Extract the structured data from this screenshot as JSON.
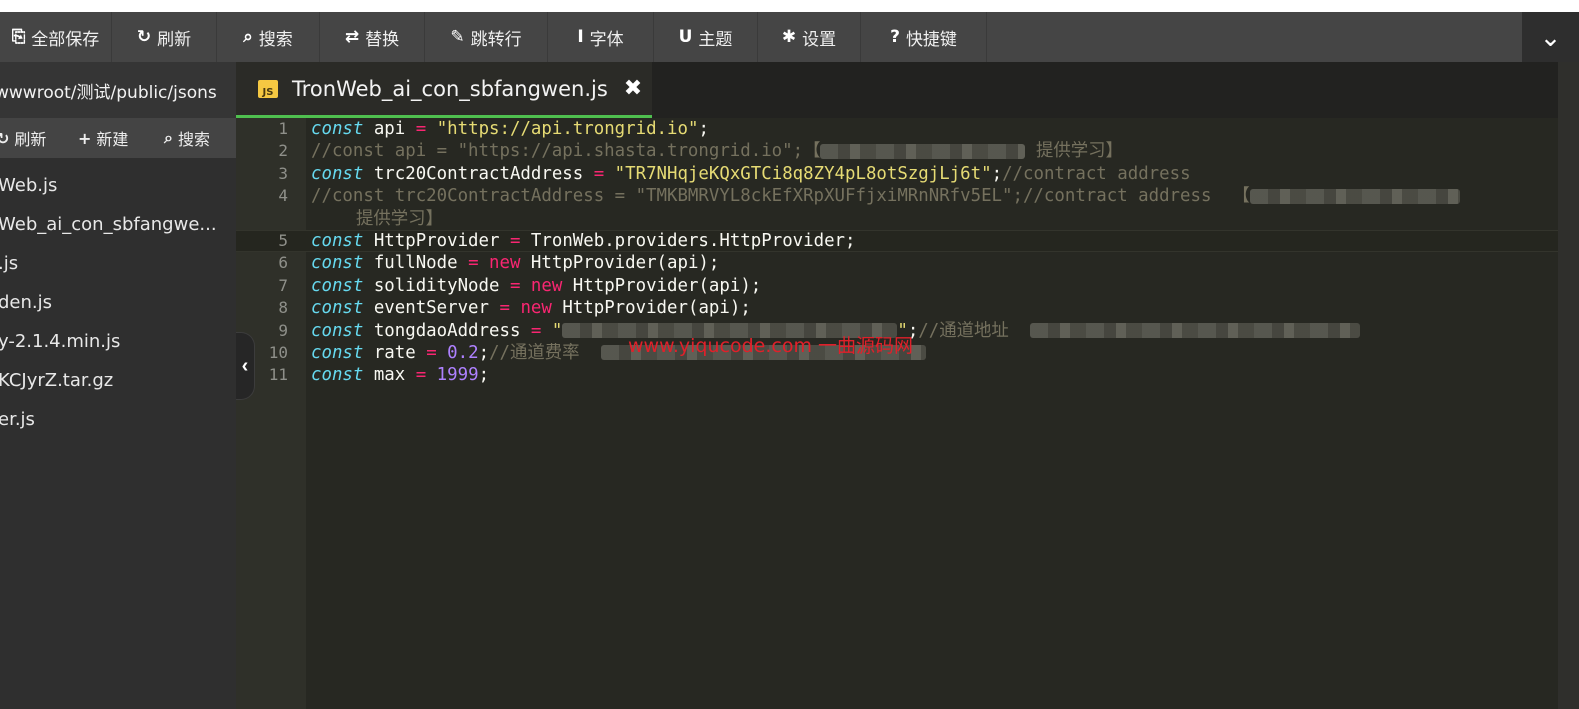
{
  "toolbar": {
    "buttons": [
      {
        "icon": "save-all-icon",
        "glyph": "⎘",
        "label": "全部保存"
      },
      {
        "icon": "refresh-icon",
        "glyph": "↻",
        "label": "刷新"
      },
      {
        "icon": "search-icon",
        "glyph": "⌕",
        "label": "搜索"
      },
      {
        "icon": "replace-icon",
        "glyph": "⇄",
        "label": "替换"
      },
      {
        "icon": "pin-icon",
        "glyph": "✎",
        "label": "跳转行"
      },
      {
        "icon": "font-icon",
        "glyph": "I",
        "label": "字体"
      },
      {
        "icon": "theme-icon",
        "glyph": "U",
        "label": "主题"
      },
      {
        "icon": "gear-icon",
        "glyph": "✱",
        "label": "设置"
      },
      {
        "icon": "help-icon",
        "glyph": "?",
        "label": "快捷键"
      }
    ],
    "collapse_glyph": "⌄"
  },
  "sidebar": {
    "path": "wwwroot/测试/public/jsons",
    "actions": [
      {
        "icon": "refresh-icon",
        "glyph": "↻",
        "label": "刷新"
      },
      {
        "icon": "plus-icon",
        "glyph": "+",
        "label": "新建"
      },
      {
        "icon": "search-icon",
        "glyph": "⌕",
        "label": "搜索"
      }
    ],
    "files": [
      "Web.js",
      "Web_ai_con_sbfangwe...",
      ".js",
      "den.js",
      "y-2.1.4.min.js",
      "KCJyrZ.tar.gz",
      "er.js"
    ],
    "collapse_glyph": "‹"
  },
  "tab": {
    "badge": "JS",
    "filename": "TronWeb_ai_con_sbfangwen.js",
    "close_glyph": "✖"
  },
  "editor": {
    "lines": [
      {
        "n": "1",
        "kw": "const",
        "rest": " api ",
        "op": "=",
        "str": "\"https://api.trongrid.io\"",
        "tail": ";"
      },
      {
        "n": "2",
        "comment": "//const api = \"https://api.shasta.trongrid.io\";【",
        "comment2": " 提供学习】"
      },
      {
        "n": "3",
        "kw": "const",
        "rest": " trc20ContractAddress ",
        "op": "=",
        "str": "\"TR7NHqjeKQxGTCi8q8ZY4pL8otSzgjLj6t\"",
        "tail": ";",
        "comment": "//contract address"
      },
      {
        "n": "4",
        "comment": "//const trc20ContractAddress = \"TMKBMRVYL8ckEfXRpXUFfjxiMRnNRfv5EL\";//contract address  【",
        "wrap": "提供学习】"
      },
      {
        "n": "5",
        "kw": "const",
        "rest": " HttpProvider ",
        "op": "=",
        "tail": " TronWeb.providers.HttpProvider;"
      },
      {
        "n": "6",
        "kw": "const",
        "rest": " fullNode ",
        "op": "=",
        "kw2": " new",
        "tail": " HttpProvider(api);"
      },
      {
        "n": "7",
        "kw": "const",
        "rest": " solidityNode ",
        "op": "=",
        "kw2": " new",
        "tail": " HttpProvider(api);"
      },
      {
        "n": "8",
        "kw": "const",
        "rest": " eventServer ",
        "op": "=",
        "kw2": " new",
        "tail": " HttpProvider(api);"
      },
      {
        "n": "9",
        "kw": "const",
        "rest": " tongdaoAddress ",
        "op": "=",
        "str_open": " \"",
        "str_close": "\"",
        "tail": ";",
        "comment": "//通道地址  "
      },
      {
        "n": "10",
        "kw": "const",
        "rest": " rate ",
        "op": "=",
        "numlit": " 0.2",
        "tail": ";",
        "comment": "//通道费率  "
      },
      {
        "n": "11",
        "kw": "const",
        "rest": " max ",
        "op": "=",
        "numlit": " 1999",
        "tail": ";"
      }
    ]
  },
  "watermark": "www.yiqucode.com  一曲源码网"
}
